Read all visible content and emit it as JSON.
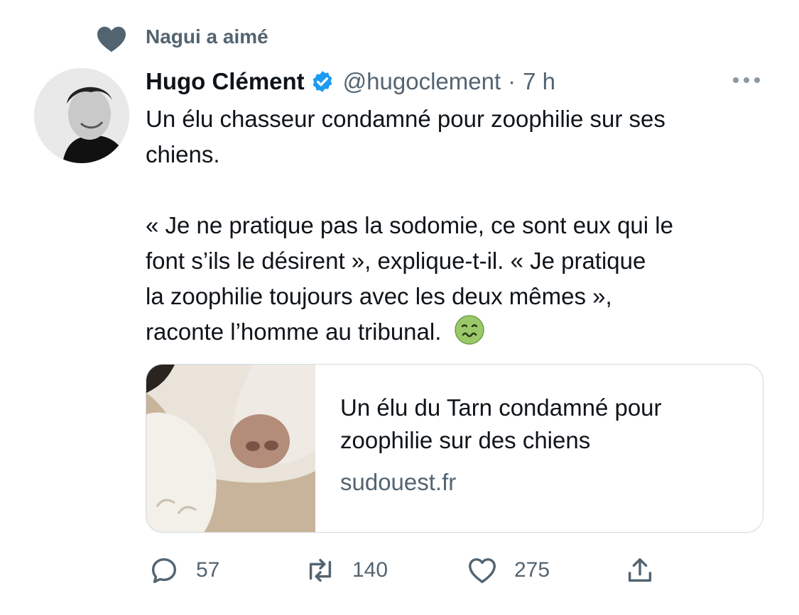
{
  "social_context": {
    "text": "Nagui a aimé",
    "icon": "heart-filled-icon"
  },
  "tweet": {
    "author_name": "Hugo Clément",
    "verified": true,
    "handle": "@hugoclement",
    "separator": "·",
    "time": "7 h",
    "lines": {
      "l1": "Un élu chasseur condamné pour zoophilie sur ses",
      "l2": "chiens.",
      "l3": "« Je ne pratique pas la sodomie, ce sont eux qui le",
      "l4": "font s’ils le désirent », explique-t-il. « Je pratique",
      "l5": "la zoophilie toujours avec les deux mêmes »,",
      "l6": "raconte l’homme au tribunal."
    },
    "emoji": "nauseated-face-emoji"
  },
  "link_card": {
    "title_line1": "Un élu du Tarn condamné pour",
    "title_line2": "zoophilie sur des chiens",
    "domain": "sudouest.fr"
  },
  "actions": {
    "reply_count": "57",
    "retweet_count": "140",
    "like_count": "275"
  },
  "colors": {
    "text": "#0f1419",
    "secondary": "#536471",
    "verified": "#1d9bf0",
    "border": "#cfd9de"
  }
}
